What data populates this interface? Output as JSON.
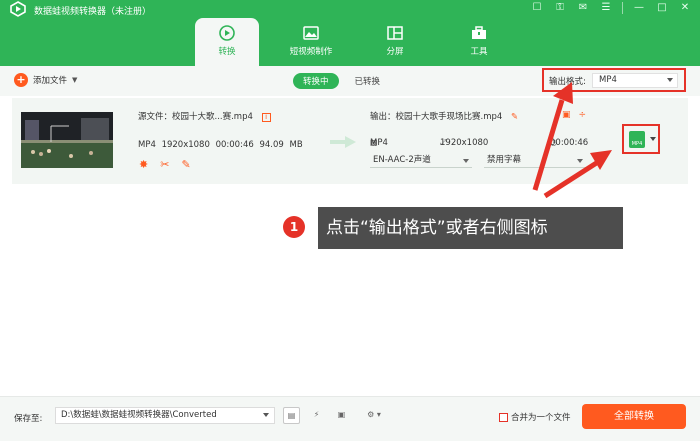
{
  "app": {
    "title": "数据蛙视频转换器（未注册）",
    "window_controls": [
      "cart-icon",
      "key-icon",
      "feedback-icon",
      "menu-icon",
      "minimize-icon",
      "maximize-icon",
      "close-icon"
    ]
  },
  "tabs": [
    {
      "label": "转换",
      "icon": "convert-icon",
      "active": true
    },
    {
      "label": "短视频制作",
      "icon": "short-video-icon",
      "active": false
    },
    {
      "label": "分屏",
      "icon": "split-screen-icon",
      "active": false
    },
    {
      "label": "工具",
      "icon": "toolbox-icon",
      "active": false
    }
  ],
  "toolbar": {
    "add_file_label": "添加文件",
    "status_active": "转换中",
    "status_done": "已转换",
    "output_format_label": "输出格式:",
    "output_format_value": "MP4"
  },
  "file": {
    "source_name": "源文件：校园十大歌...赛.mp4",
    "source_info_badge": "i",
    "source_format": "MP4",
    "source_resolution": "1920x1080",
    "source_duration": "00:00:46",
    "source_size": "94.09 MB",
    "output_name": "输出：校园十大歌手现场比赛.mp4",
    "output_format": "MP4",
    "output_resolution": "1920x1080",
    "output_duration": "00:00:46",
    "audio_track": "EN-AAC-2声道",
    "subtitle": "禁用字幕",
    "format_icon_text": "MP4"
  },
  "callout": {
    "number": "1",
    "text": "点击“输出格式”或者右侧图标"
  },
  "bottom": {
    "save_label": "保存至:",
    "save_path": "D:\\数据蛙\\数据蛙视频转换器\\Converted",
    "merge_label": "合并为一个文件",
    "convert_all_label": "全部转换"
  },
  "colors": {
    "brand_green": "#2fb457",
    "accent_orange": "#ff5a1f",
    "highlight_red": "#e53228"
  }
}
